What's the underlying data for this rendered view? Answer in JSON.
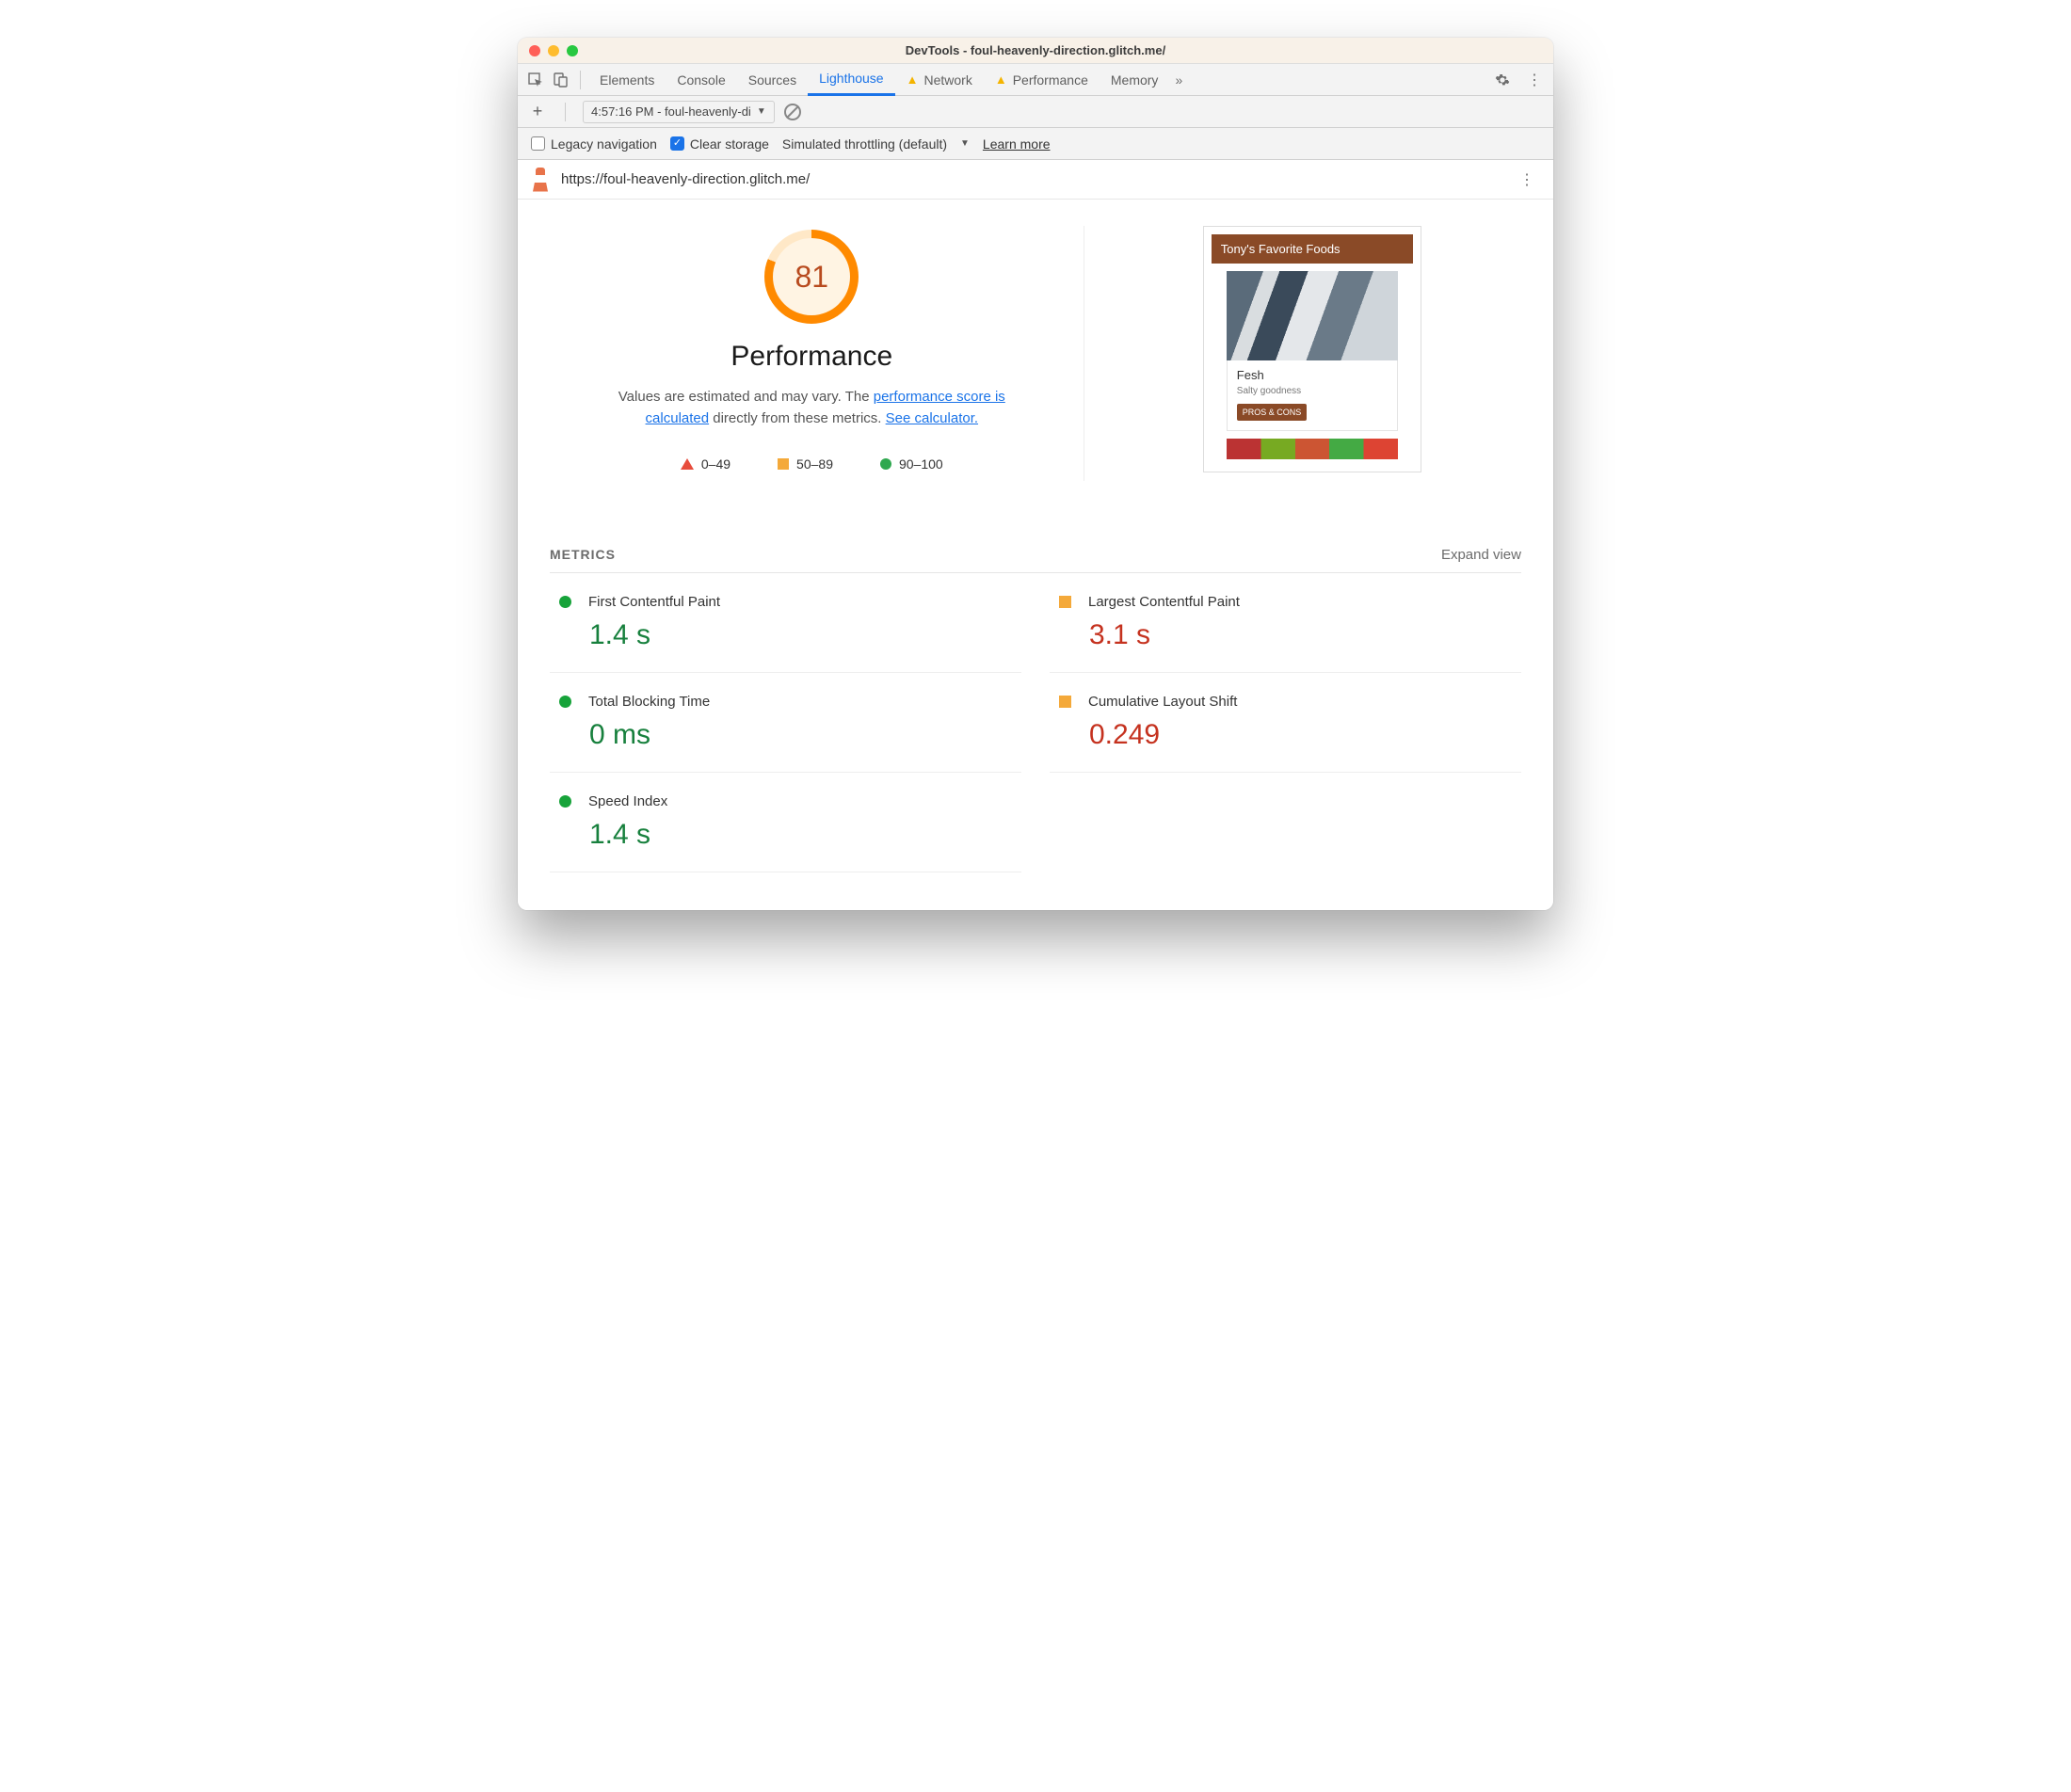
{
  "window": {
    "title": "DevTools - foul-heavenly-direction.glitch.me/"
  },
  "tabs": {
    "items": [
      "Elements",
      "Console",
      "Sources",
      "Lighthouse",
      "Network",
      "Performance",
      "Memory"
    ],
    "active": "Lighthouse",
    "warn": [
      "Network",
      "Performance"
    ]
  },
  "secbar": {
    "report_label": "4:57:16 PM - foul-heavenly-di"
  },
  "optbar": {
    "legacy": "Legacy navigation",
    "clear": "Clear storage",
    "throttle": "Simulated throttling (default)",
    "learn": "Learn more"
  },
  "urlbar": {
    "url": "https://foul-heavenly-direction.glitch.me/"
  },
  "score": {
    "value": "81",
    "title": "Performance",
    "desc_a": "Values are estimated and may vary. The ",
    "link1": "performance score is calculated",
    "desc_b": " directly from these metrics. ",
    "link2": "See calculator."
  },
  "legend": {
    "a": "0–49",
    "b": "50–89",
    "c": "90–100"
  },
  "preview": {
    "header": "Tony's Favorite Foods",
    "card_title": "Fesh",
    "card_sub": "Salty goodness",
    "card_btn": "PROS & CONS"
  },
  "metrics": {
    "title": "METRICS",
    "expand": "Expand view",
    "items": [
      {
        "name": "First Contentful Paint",
        "value": "1.4 s",
        "status": "green"
      },
      {
        "name": "Largest Contentful Paint",
        "value": "3.1 s",
        "status": "orange"
      },
      {
        "name": "Total Blocking Time",
        "value": "0 ms",
        "status": "green"
      },
      {
        "name": "Cumulative Layout Shift",
        "value": "0.249",
        "status": "orange"
      },
      {
        "name": "Speed Index",
        "value": "1.4 s",
        "status": "green"
      }
    ]
  }
}
